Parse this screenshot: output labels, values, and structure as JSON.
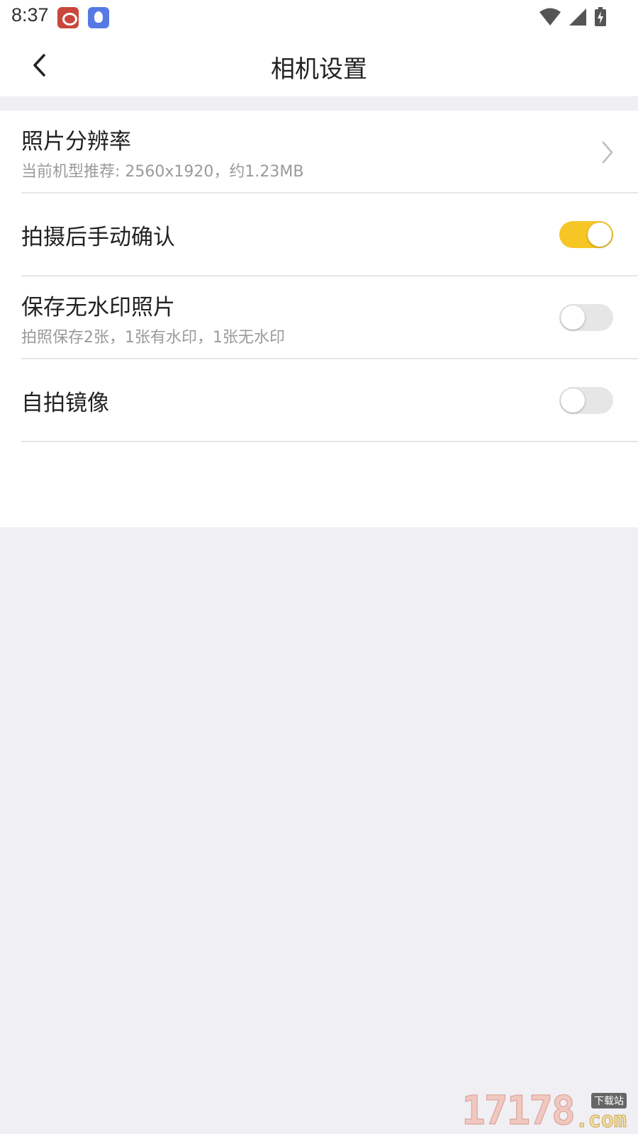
{
  "status_bar": {
    "time": "8:37",
    "apps": [
      "weibo-icon",
      "bird-icon"
    ],
    "indicators": [
      "wifi-icon",
      "signal-icon",
      "battery-charging-icon"
    ]
  },
  "header": {
    "title": "相机设置",
    "back_icon": "chevron-left-icon"
  },
  "settings": [
    {
      "id": "photo-resolution",
      "title": "照片分辨率",
      "subtitle": "当前机型推荐: 2560x1920，约1.23MB",
      "control": "chevron-right-icon"
    },
    {
      "id": "manual-confirm",
      "title": "拍摄后手动确认",
      "control": "toggle",
      "enabled": true
    },
    {
      "id": "save-no-watermark",
      "title": "保存无水印照片",
      "subtitle": "拍照保存2张，1张有水印，1张无水印",
      "control": "toggle",
      "enabled": false
    },
    {
      "id": "selfie-mirror",
      "title": "自拍镜像",
      "control": "toggle",
      "enabled": false
    }
  ],
  "watermark": {
    "number": "17178",
    "badge": "下载站",
    "suffix": ".com"
  },
  "colors": {
    "accent_toggle_on": "#f6c624",
    "toggle_off": "#e6e6e6",
    "page_background": "#efeff4",
    "card_background": "#ffffff"
  }
}
